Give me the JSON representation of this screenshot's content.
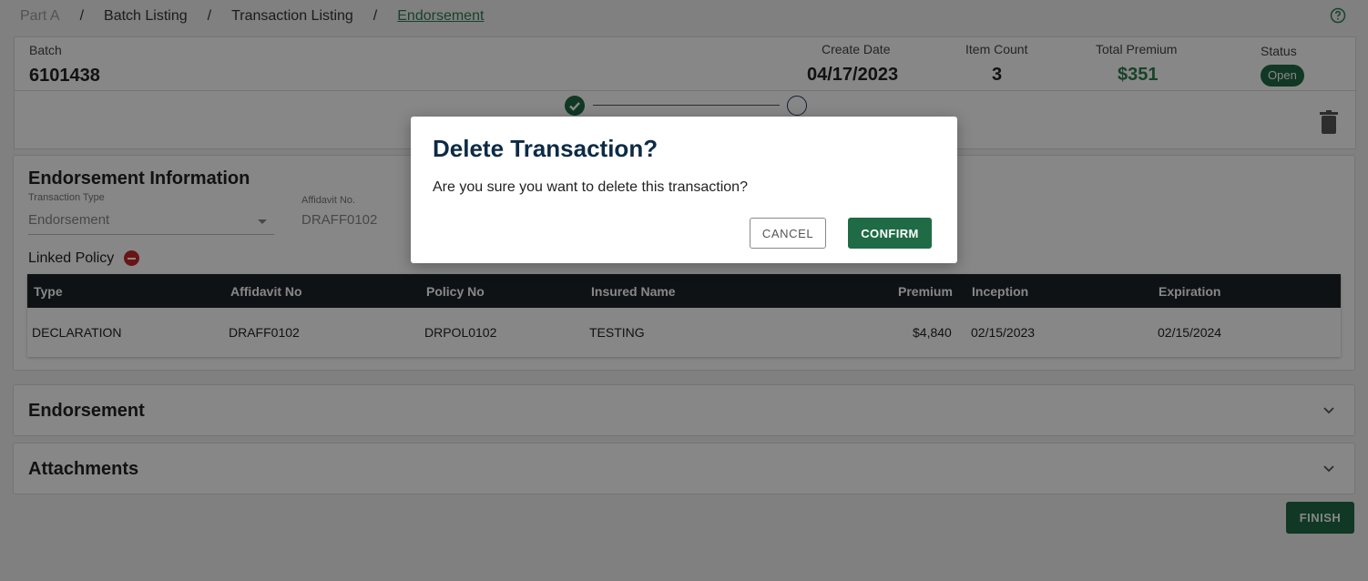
{
  "breadcrumb": {
    "items": [
      "Part A",
      "Batch Listing",
      "Transaction Listing",
      "Endorsement"
    ],
    "separator": "/"
  },
  "batch": {
    "batch_label": "Batch",
    "batch_value": "6101438",
    "create_date_label": "Create Date",
    "create_date_value": "04/17/2023",
    "item_count_label": "Item Count",
    "item_count_value": "3",
    "total_premium_label": "Total Premium",
    "total_premium_value": "$351",
    "status_label": "Status",
    "status_value": "Open"
  },
  "stepper": {
    "steps_completed": 1,
    "steps_total": 2
  },
  "endorsement_info": {
    "title": "Endorsement Information",
    "transaction_type_label": "Transaction Type",
    "transaction_type_value": "Endorsement",
    "affidavit_label": "Affidavit No.",
    "affidavit_value": "DRAFF0102",
    "linked_policy_label": "Linked Policy"
  },
  "linked_table": {
    "columns": [
      "Type",
      "Affidavit No",
      "Policy No",
      "Insured Name",
      "Premium",
      "Inception",
      "Expiration"
    ],
    "rows": [
      [
        "DECLARATION",
        "DRAFF0102",
        "DRPOL0102",
        "TESTING",
        "$4,840",
        "02/15/2023",
        "02/15/2024"
      ]
    ]
  },
  "sections": {
    "endorsement_title": "Endorsement",
    "attachments_title": "Attachments"
  },
  "actions": {
    "finish_label": "FINISH"
  },
  "modal": {
    "title": "Delete Transaction?",
    "body": "Are you sure you want to delete this transaction?",
    "cancel_label": "CANCEL",
    "confirm_label": "CONFIRM"
  },
  "icons": {
    "help": "help-icon",
    "check": "check-circle-icon",
    "trash": "trash-icon",
    "remove": "remove-circle-icon",
    "chevron": "chevron-down-icon"
  },
  "colors": {
    "brand_green": "#1f6b45",
    "premium_green": "#2e7d4f",
    "table_header": "#1e2229",
    "danger": "#c62828",
    "title_navy": "#0d2b45"
  }
}
